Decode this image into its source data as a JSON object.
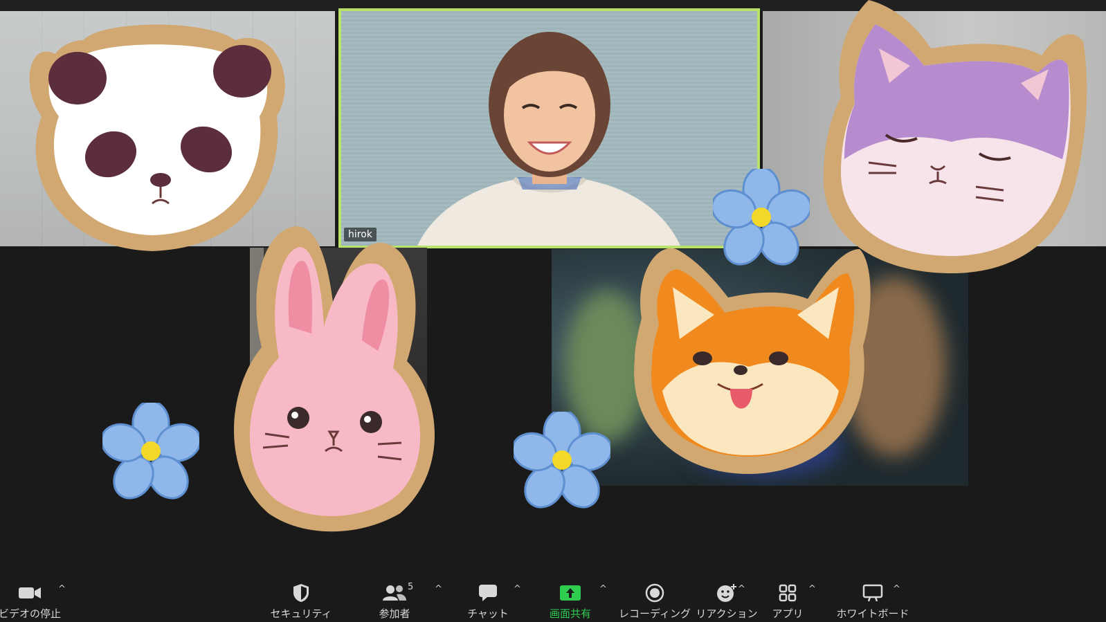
{
  "participant": {
    "name_tag": "hirok"
  },
  "toolbar": {
    "video": {
      "label": "ビデオの停止",
      "icon": "video-camera-icon"
    },
    "security": {
      "label": "セキュリティ",
      "icon": "shield-icon"
    },
    "participants": {
      "label": "参加者",
      "count": "5",
      "icon": "people-icon"
    },
    "chat": {
      "label": "チャット",
      "icon": "chat-bubble-icon"
    },
    "share": {
      "label": "画面共有",
      "icon": "share-screen-icon"
    },
    "record": {
      "label": "レコーディング",
      "icon": "record-icon"
    },
    "reactions": {
      "label": "リアクション",
      "icon": "emoji-icon"
    },
    "apps": {
      "label": "アプリ",
      "icon": "apps-icon"
    },
    "whiteboard": {
      "label": "ホワイトボード",
      "icon": "whiteboard-icon"
    },
    "caret": "^"
  },
  "colors": {
    "active_speaker_border": "#b9e26a",
    "share_green": "#2fcc52",
    "toolbar_bg": "#1a1a1a"
  }
}
